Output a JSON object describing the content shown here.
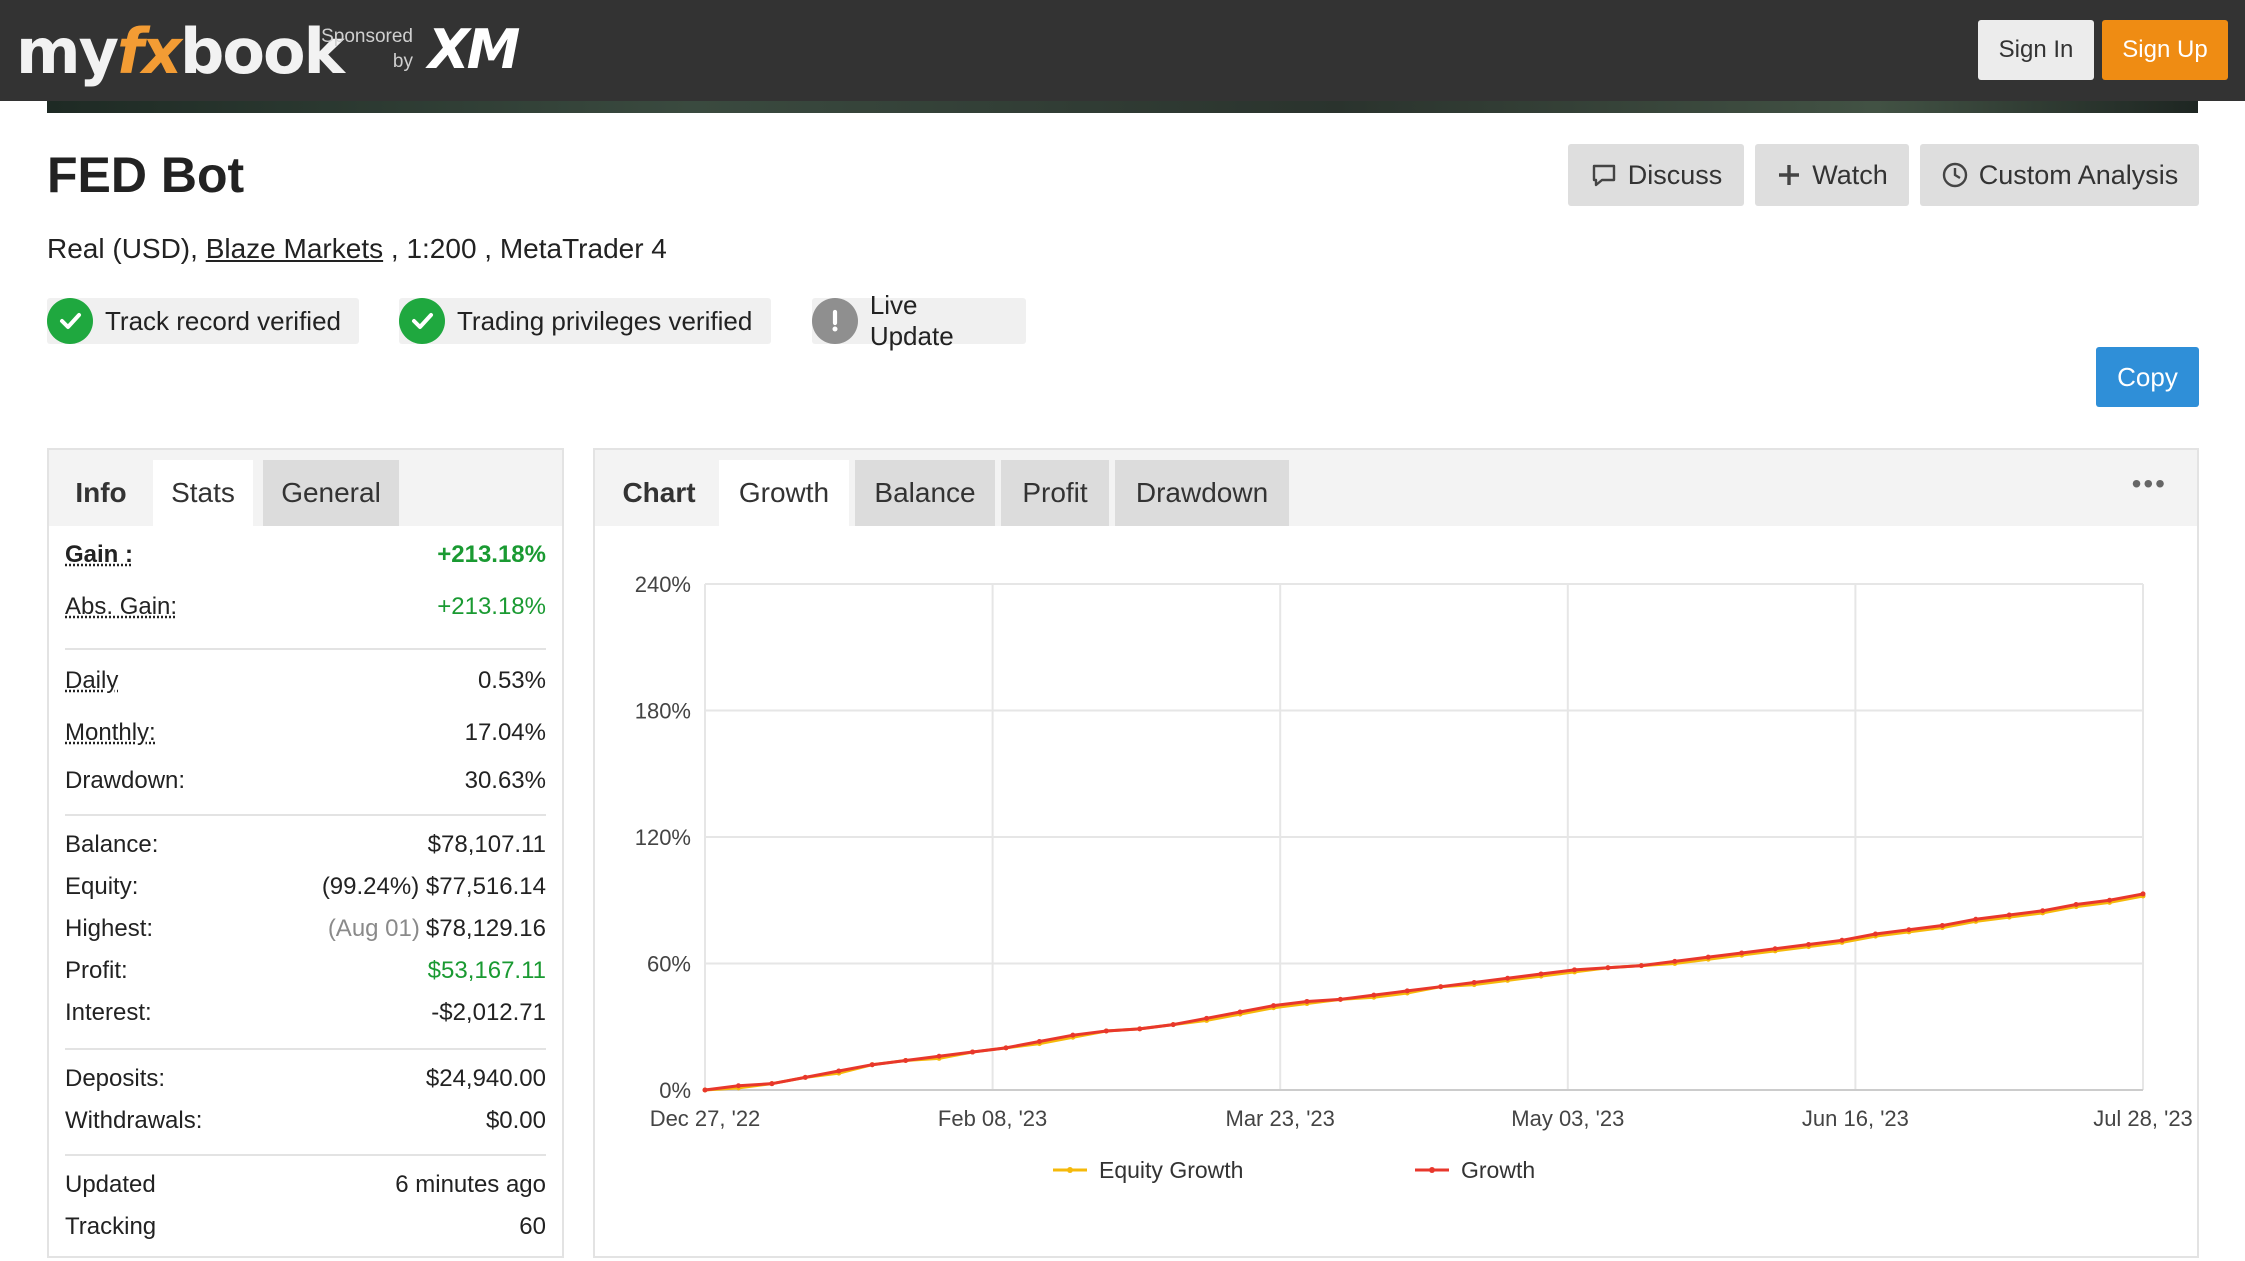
{
  "header": {
    "logo_left": "my",
    "logo_fx": "fx",
    "logo_right": "book",
    "sponsored": "Sponsored by",
    "sponsor_brand": "XM",
    "sign_in": "Sign In",
    "sign_up": "Sign Up"
  },
  "system": {
    "title": "FED Bot",
    "account_type": "Real (USD),",
    "broker": "Blaze Markets",
    "leverage": " , 1:200 , MetaTrader 4"
  },
  "actions": {
    "discuss": "Discuss",
    "watch": "Watch",
    "custom": "Custom Analysis",
    "copy": "Copy"
  },
  "badges": [
    {
      "label": "Track record verified",
      "status": "verified"
    },
    {
      "label": "Trading privileges verified",
      "status": "verified"
    },
    {
      "label": "Live Update",
      "status": "warning"
    }
  ],
  "left_tabs": [
    "Info",
    "Stats",
    "General"
  ],
  "stats": {
    "gain": {
      "label": "Gain :",
      "value": "+213.18%"
    },
    "abs_gain": {
      "label": "Abs. Gain:",
      "value": "+213.18%"
    },
    "daily": {
      "label": "Daily",
      "value": "0.53%"
    },
    "monthly": {
      "label": "Monthly:",
      "value": "17.04%"
    },
    "drawdown": {
      "label": "Drawdown:",
      "value": "30.63%"
    },
    "balance": {
      "label": "Balance:",
      "value": "$78,107.11"
    },
    "equity": {
      "label": "Equity:",
      "note": "(99.24%)",
      "value": "$77,516.14"
    },
    "highest": {
      "label": "Highest:",
      "note": "(Aug 01)",
      "value": "$78,129.16"
    },
    "profit": {
      "label": "Profit:",
      "value": "$53,167.11"
    },
    "interest": {
      "label": "Interest:",
      "value": "-$2,012.71"
    },
    "deposits": {
      "label": "Deposits:",
      "value": "$24,940.00"
    },
    "withdrawals": {
      "label": "Withdrawals:",
      "value": "$0.00"
    },
    "updated": {
      "label": "Updated",
      "value": "6 minutes ago"
    },
    "tracking": {
      "label": "Tracking",
      "value": "60"
    }
  },
  "right_tabs": [
    "Chart",
    "Growth",
    "Balance",
    "Profit",
    "Drawdown"
  ],
  "more_label": "•••",
  "chart_data": {
    "type": "line",
    "ylim": [
      0,
      240
    ],
    "yticks": [
      "0%",
      "60%",
      "120%",
      "180%",
      "240%"
    ],
    "xtick_labels": [
      "Dec 27, '22",
      "Feb 08, '23",
      "Mar 23, '23",
      "May 03, '23",
      "Jun 16, '23",
      "Jul 28, '23"
    ],
    "x_range_days": [
      0,
      215
    ],
    "colors": {
      "growth": "#e8372c",
      "equity": "#f5b90a",
      "bar_up": "#8fce8f",
      "bar_down": "#ee5a5a"
    },
    "series": [
      {
        "name": "Growth",
        "points": [
          [
            0,
            0
          ],
          [
            5,
            2
          ],
          [
            10,
            3
          ],
          [
            15,
            6
          ],
          [
            20,
            9
          ],
          [
            25,
            12
          ],
          [
            30,
            14
          ],
          [
            35,
            16
          ],
          [
            40,
            18
          ],
          [
            45,
            20
          ],
          [
            50,
            23
          ],
          [
            55,
            26
          ],
          [
            60,
            28
          ],
          [
            65,
            29
          ],
          [
            70,
            31
          ],
          [
            75,
            34
          ],
          [
            80,
            37
          ],
          [
            85,
            40
          ],
          [
            90,
            42
          ],
          [
            95,
            43
          ],
          [
            100,
            45
          ],
          [
            105,
            47
          ],
          [
            110,
            49
          ],
          [
            115,
            51
          ],
          [
            120,
            53
          ],
          [
            125,
            55
          ],
          [
            130,
            57
          ],
          [
            135,
            58
          ],
          [
            140,
            59
          ],
          [
            145,
            61
          ],
          [
            150,
            63
          ],
          [
            155,
            65
          ],
          [
            160,
            67
          ],
          [
            165,
            69
          ],
          [
            170,
            71
          ],
          [
            175,
            74
          ],
          [
            180,
            76
          ],
          [
            185,
            78
          ],
          [
            190,
            81
          ],
          [
            195,
            83
          ],
          [
            200,
            85
          ],
          [
            205,
            88
          ],
          [
            210,
            90
          ],
          [
            215,
            93
          ]
        ]
      },
      {
        "name": "Equity Growth",
        "points": [
          [
            0,
            0
          ],
          [
            5,
            1
          ],
          [
            10,
            3
          ],
          [
            15,
            6
          ],
          [
            20,
            8
          ],
          [
            25,
            12
          ],
          [
            30,
            14
          ],
          [
            35,
            15
          ],
          [
            40,
            18
          ],
          [
            45,
            20
          ],
          [
            50,
            22
          ],
          [
            55,
            25
          ],
          [
            60,
            28
          ],
          [
            65,
            29
          ],
          [
            70,
            31
          ],
          [
            75,
            33
          ],
          [
            80,
            36
          ],
          [
            85,
            39
          ],
          [
            90,
            41
          ],
          [
            95,
            43
          ],
          [
            100,
            44
          ],
          [
            105,
            46
          ],
          [
            110,
            49
          ],
          [
            115,
            50
          ],
          [
            120,
            52
          ],
          [
            125,
            54
          ],
          [
            130,
            56
          ],
          [
            135,
            58
          ],
          [
            140,
            59
          ],
          [
            145,
            60
          ],
          [
            150,
            62
          ],
          [
            155,
            64
          ],
          [
            160,
            66
          ],
          [
            165,
            68
          ],
          [
            170,
            70
          ],
          [
            175,
            73
          ],
          [
            180,
            75
          ],
          [
            185,
            77
          ],
          [
            190,
            80
          ],
          [
            195,
            82
          ],
          [
            200,
            84
          ],
          [
            205,
            87
          ],
          [
            210,
            89
          ],
          [
            215,
            92
          ]
        ]
      }
    ]
  }
}
